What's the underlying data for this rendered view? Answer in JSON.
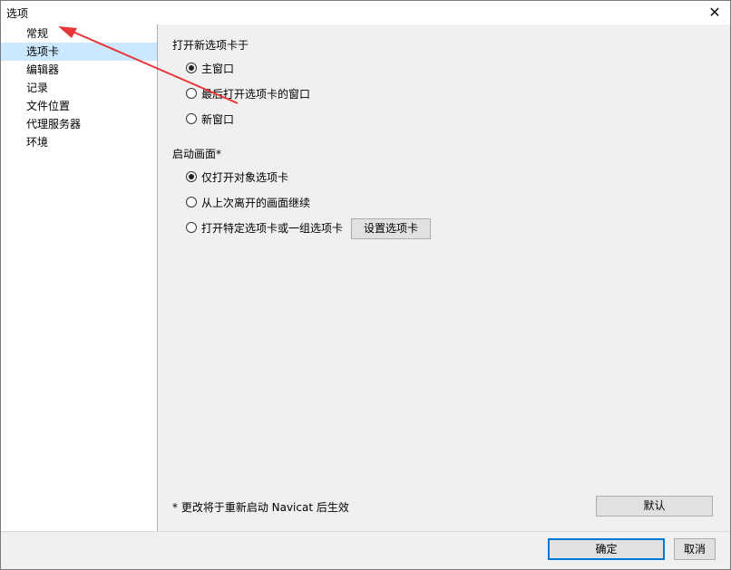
{
  "window": {
    "title": "选项"
  },
  "sidebar": {
    "items": [
      {
        "label": "常规"
      },
      {
        "label": "选项卡"
      },
      {
        "label": "编辑器"
      },
      {
        "label": "记录"
      },
      {
        "label": "文件位置"
      },
      {
        "label": "代理服务器"
      },
      {
        "label": "环境"
      }
    ],
    "selected_index": 1
  },
  "open_new_tab": {
    "heading": "打开新选项卡于",
    "options": [
      {
        "label": "主窗口",
        "checked": true
      },
      {
        "label": "最后打开选项卡的窗口",
        "checked": false
      },
      {
        "label": "新窗口",
        "checked": false
      }
    ]
  },
  "startup": {
    "heading": "启动画面*",
    "options": [
      {
        "label": "仅打开对象选项卡",
        "checked": true
      },
      {
        "label": "从上次离开的画面继续",
        "checked": false
      },
      {
        "label": "打开特定选项卡或一组选项卡",
        "checked": false
      }
    ],
    "set_tabs_button": "设置选项卡"
  },
  "footer": {
    "note": "* 更改将于重新启动 Navicat 后生效",
    "default_button": "默认",
    "ok_button": "确定",
    "cancel_button": "取消"
  },
  "colors": {
    "selection": "#cce8ff",
    "annotation_arrow": "#e8373a",
    "focus_border": "#0078d7"
  }
}
